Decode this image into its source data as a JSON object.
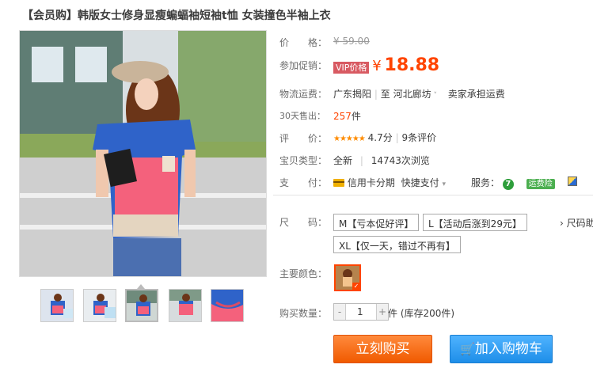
{
  "product": {
    "title": "【会员购】韩版女士修身显瘦蝙蝠袖短袖t恤 女装撞色半袖上衣"
  },
  "price": {
    "label": "价　　格：",
    "old_symbol": "¥",
    "old_value": "59.00",
    "promo_label": "参加促销：",
    "vip_tag": "VIP价格",
    "symbol": "¥",
    "value": "18.88"
  },
  "shipping": {
    "label": "物流运费：",
    "from": "广东揭阳",
    "sep": "|",
    "to_prefix": "至",
    "to": "河北廊坊",
    "fee": "卖家承担运费"
  },
  "sales": {
    "label": "30天售出：",
    "count": "257",
    "unit": "件"
  },
  "rating": {
    "label": "评　　价：",
    "stars": "★★★★★",
    "score": "4.7分",
    "sep": "|",
    "reviews": "9条评价"
  },
  "item_type": {
    "label": "宝贝类型：",
    "value": "全新",
    "sep": "|",
    "views": "14743次浏览"
  },
  "payment": {
    "label": "支　　付：",
    "credit": "信用卡分期",
    "quick": "快捷支付",
    "service_label": "服务：",
    "freight_badge": "运费险"
  },
  "size": {
    "label": "尺　　码：",
    "options": [
      "M【亏本促好评】",
      "L【活动后涨到29元】",
      "XL【仅一天，错过不再有】"
    ],
    "size_chart": "› 尺码助"
  },
  "color": {
    "label": "主要颜色："
  },
  "quantity": {
    "label": "购买数量：",
    "minus": "-",
    "value": "1",
    "plus": "+",
    "stock": "件 (库存200件)"
  },
  "actions": {
    "buy": "立刻购买",
    "cart": "加入购物车"
  },
  "colors": {
    "accent": "#ff4400",
    "buy_button": "#f05a00",
    "cart_button": "#1e8ee8"
  }
}
